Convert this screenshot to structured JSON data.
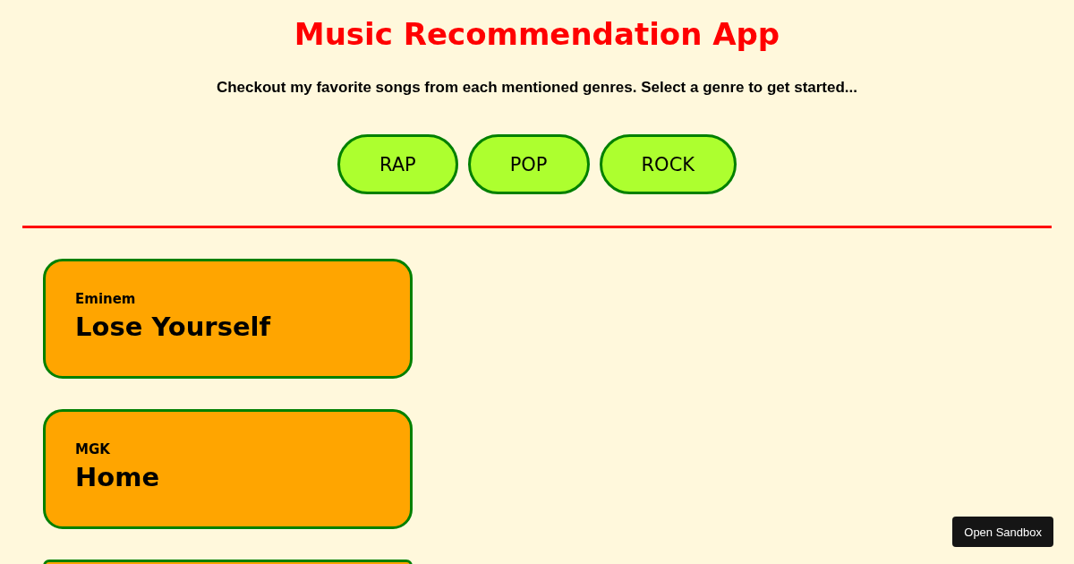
{
  "app": {
    "title": "Music Recommendation App",
    "subtitle": "Checkout my favorite songs from each mentioned genres. Select a genre to get started..."
  },
  "genres": [
    {
      "label": "RAP"
    },
    {
      "label": "POP"
    },
    {
      "label": "ROCK"
    }
  ],
  "songs": [
    {
      "kind": "song",
      "artist": "Eminem",
      "title": "Lose Yourself"
    },
    {
      "kind": "song",
      "artist": "MGK",
      "title": "Home"
    },
    {
      "kind": "cut-off"
    }
  ],
  "sandbox_button": {
    "label": "Open Sandbox"
  }
}
